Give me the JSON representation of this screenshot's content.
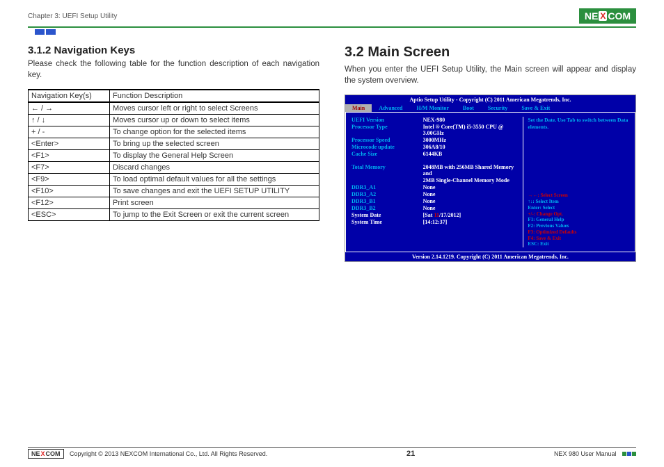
{
  "header": {
    "chapter": "Chapter 3: UEFI Setup Utility",
    "logo_left": "NE",
    "logo_x": "X",
    "logo_right": "COM"
  },
  "left_col": {
    "heading": "3.1.2  Navigation Keys",
    "intro": "Please check the following table for the function description of each navigation key.",
    "table_header_key": "Navigation Key(s)",
    "table_header_desc": "Function Description",
    "rows": [
      {
        "key": "← / →",
        "desc": "Moves cursor left or right to select Screens"
      },
      {
        "key": "↑ / ↓",
        "desc": "Moves cursor up or down to select items"
      },
      {
        "key": "+ / -",
        "desc": "To change option for the selected items"
      },
      {
        "key": "<Enter>",
        "desc": "To bring up the selected screen"
      },
      {
        "key": "<F1>",
        "desc": "To display the General Help Screen"
      },
      {
        "key": "<F7>",
        "desc": "Discard changes"
      },
      {
        "key": "<F9>",
        "desc": "To load optimal default values for all the settings"
      },
      {
        "key": "<F10>",
        "desc": "To save changes and exit the UEFI SETUP UTILITY"
      },
      {
        "key": "<F12>",
        "desc": "Print screen"
      },
      {
        "key": "<ESC>",
        "desc": "To jump to the Exit Screen or exit the current screen"
      }
    ]
  },
  "right_col": {
    "heading": "3.2  Main Screen",
    "intro": "When you enter the UEFI Setup Utility, the Main screen will appear and display the system overview."
  },
  "bios": {
    "title": "Aptio Setup Utility - Copyright (C) 2011 American Megatrends, Inc.",
    "tabs": [
      "Main",
      "Advanced",
      "H/M Monitor",
      "Boot",
      "Security",
      "Save & Exit"
    ],
    "info": [
      {
        "label": "UEFI Version",
        "value": "NEX-980"
      },
      {
        "label": "Processor Type",
        "value": "Intel ® Core(TM) i5-3550 CPU @ 3.00GHz"
      },
      {
        "label": "Processor Speed",
        "value": "3000MHz"
      },
      {
        "label": "Microcode update",
        "value": "306A8/10"
      },
      {
        "label": "Cache Size",
        "value": "6144KB"
      }
    ],
    "total_memory_label": "Total Memory",
    "total_memory_val_1": "2048MB with 256MB Shared Memory and",
    "total_memory_val_2": "2MB Single-Channel Memory Mode",
    "slots": [
      {
        "label": "DDR3_A1",
        "value": "None"
      },
      {
        "label": "DDR3_A2",
        "value": "None"
      },
      {
        "label": "DDR3_B1",
        "value": "None"
      },
      {
        "label": "DDR3_B2",
        "value": "None"
      }
    ],
    "system_date_label": "System Date",
    "system_date_prefix": "[Sat ",
    "system_date_month": "11",
    "system_date_suffix": "/17/2012]",
    "system_time_label": "System Time",
    "system_time_value": "[14:12:37]",
    "help_top": "Set the Date. Use Tab to switch between Data elements.",
    "help_list": [
      {
        "t": "→←: Select Screen",
        "red": true
      },
      {
        "t": "↑↓: Select Item",
        "red": false
      },
      {
        "t": "Enter: Select",
        "red": false
      },
      {
        "t": "+/-: Change Opt.",
        "red": true
      },
      {
        "t": "F1: General Help",
        "red": false
      },
      {
        "t": "F2: Previous Values",
        "red": false
      },
      {
        "t": "F3: Optimized Defaults",
        "red": true
      },
      {
        "t": "F4: Save & Exit",
        "red": true
      },
      {
        "t": "ESC: Exit",
        "red": false
      }
    ],
    "footer": "Version 2.14.1219. Copyright (C) 2011 American Megatrends, Inc."
  },
  "footer": {
    "logo_left": "NE",
    "logo_x": "X",
    "logo_right": "COM",
    "copyright": "Copyright © 2013 NEXCOM International Co., Ltd. All Rights Reserved.",
    "page": "21",
    "manual": "NEX 980 User Manual"
  }
}
